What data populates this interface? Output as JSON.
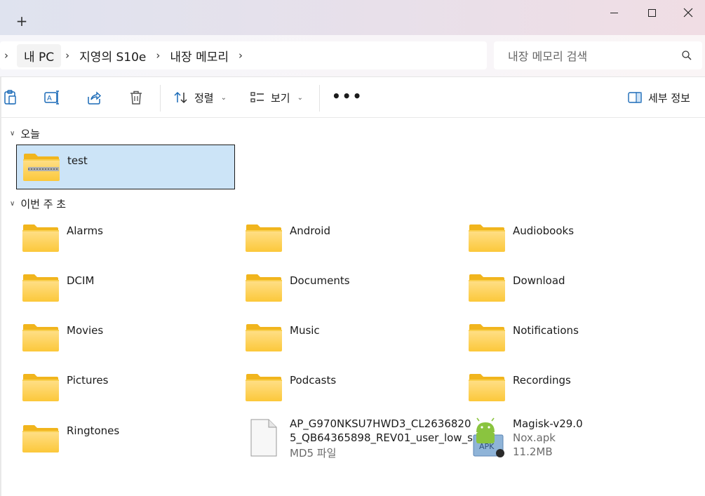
{
  "window": {
    "new_tab_symbol": "+"
  },
  "address": {
    "crumbs": [
      "내 PC",
      "지영의 S10e",
      "내장 메모리"
    ]
  },
  "search": {
    "placeholder": "내장 메모리 검색"
  },
  "toolbar": {
    "sort_label": "정렬",
    "view_label": "보기",
    "more_label": "•••",
    "details_label": "세부 정보"
  },
  "groups": {
    "today": "오늘",
    "this_week": "이번 주 초"
  },
  "items": {
    "test": "test",
    "alarms": "Alarms",
    "android": "Android",
    "audiobooks": "Audiobooks",
    "dcim": "DCIM",
    "documents": "Documents",
    "download": "Download",
    "movies": "Movies",
    "music": "Music",
    "notifications": "Notifications",
    "pictures": "Pictures",
    "podcasts": "Podcasts",
    "recordings": "Recordings",
    "ringtones": "Ringtones",
    "ap_file": {
      "name_line1": "AP_G970NKSU7HWD3_CL2636820",
      "name_line2": "5_QB64365898_REV01_user_low_s...",
      "type": "MD5 파일"
    },
    "magisk": {
      "name": "Magisk-v29.0",
      "type": "Nox.apk",
      "size": "11.2MB"
    }
  },
  "colors": {
    "selection_bg": "#cce4f7",
    "folder_yellow": "#f8c22c",
    "folder_light": "#fcd86a"
  }
}
